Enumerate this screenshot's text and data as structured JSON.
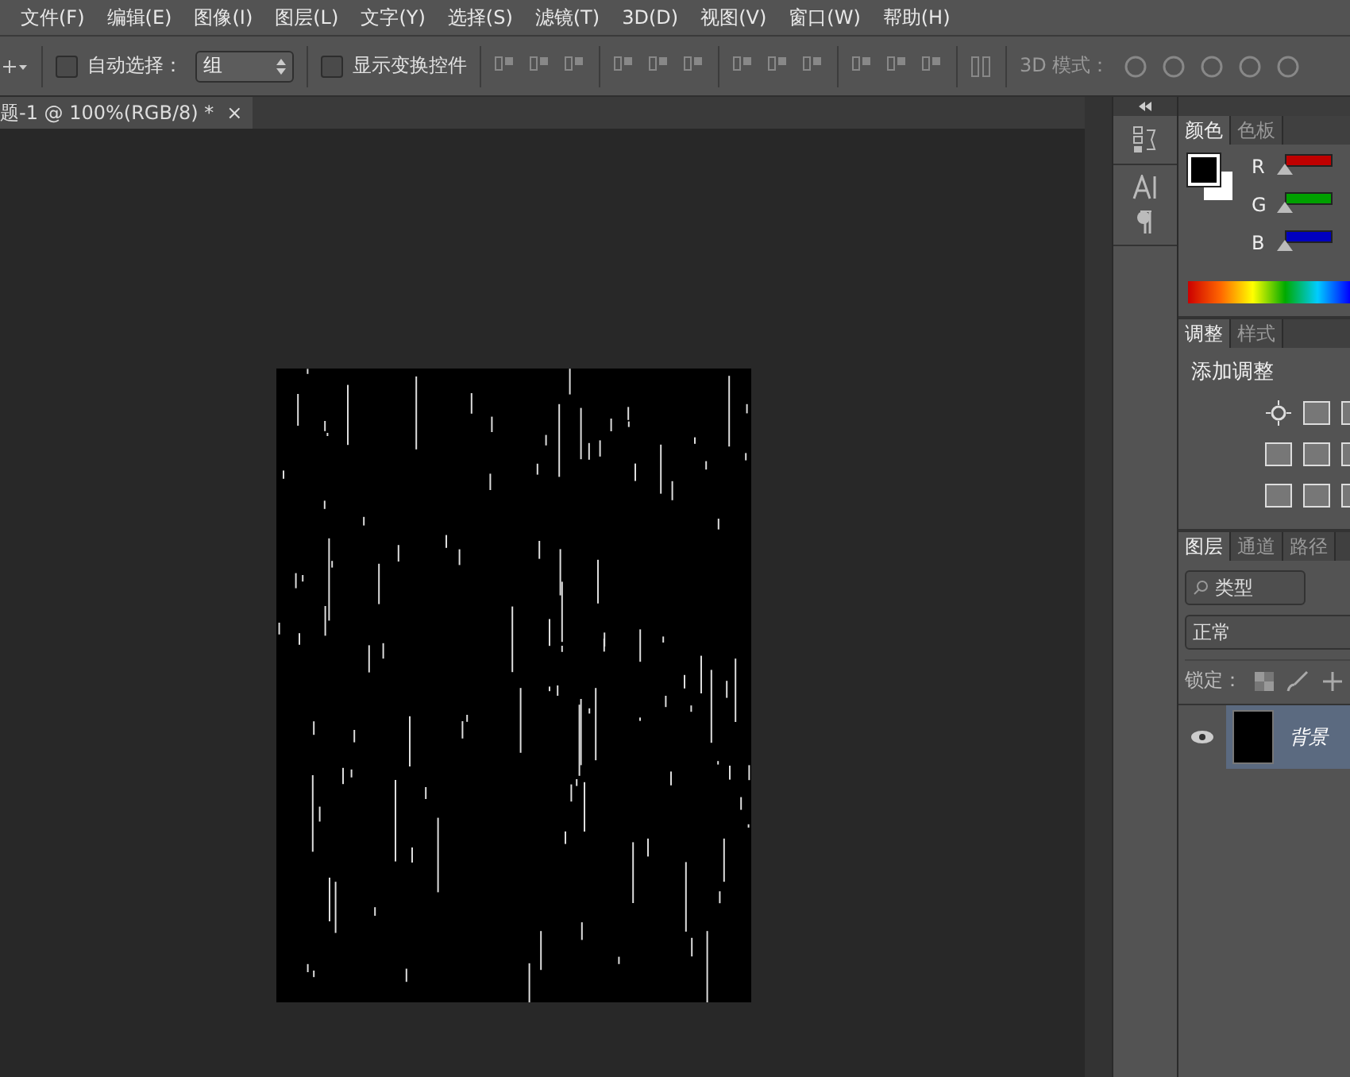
{
  "menu": [
    "文件(F)",
    "编辑(E)",
    "图像(I)",
    "图层(L)",
    "文字(Y)",
    "选择(S)",
    "滤镜(T)",
    "3D(D)",
    "视图(V)",
    "窗口(W)",
    "帮助(H)"
  ],
  "options": {
    "auto_select": {
      "label": "自动选择：",
      "checked": false
    },
    "auto_select_value": "组",
    "show_transform": {
      "label": "显示变换控件",
      "checked": false
    },
    "mode_3d_label": "3D 模式："
  },
  "document_tab": {
    "title": "题-1 @ 100%(RGB/8) *",
    "close": "×"
  },
  "color_panel": {
    "tabs": [
      {
        "label": "颜色",
        "selected": true
      },
      {
        "label": "色板",
        "selected": false
      }
    ],
    "sliders": [
      {
        "name": "R",
        "level": 0,
        "color": "#c00000"
      },
      {
        "name": "G",
        "level": 0,
        "color": "#00a000"
      },
      {
        "name": "B",
        "level": 0,
        "color": "#0000c0"
      }
    ]
  },
  "adjust_panel": {
    "tabs": [
      {
        "label": "调整",
        "selected": true
      },
      {
        "label": "样式",
        "selected": false
      }
    ],
    "heading": "添加调整"
  },
  "layers_panel": {
    "tabs": [
      {
        "label": "图层",
        "selected": true
      },
      {
        "label": "通道",
        "selected": false
      },
      {
        "label": "路径",
        "selected": false
      }
    ],
    "filter": "类型",
    "blend_mode": "正常",
    "lock_label": "锁定：",
    "layers": [
      {
        "name": "背景",
        "visible": true,
        "selected": true
      }
    ]
  }
}
